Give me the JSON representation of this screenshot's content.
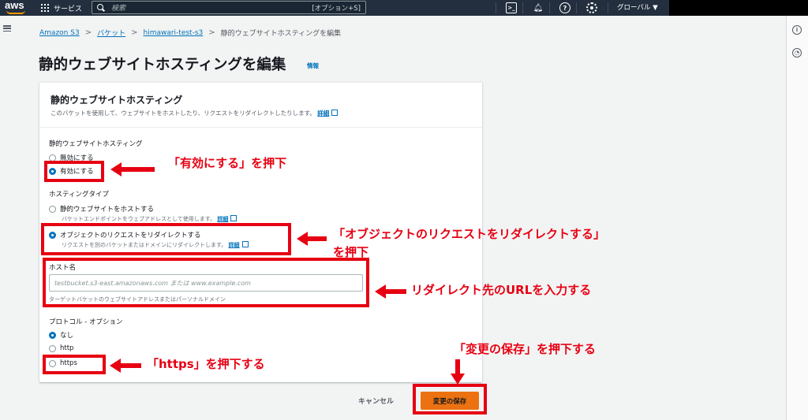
{
  "nav": {
    "logo": "aws",
    "services": "サービス",
    "search_placeholder": "検索",
    "search_shortcut": "[オプション+S]",
    "region": "グローバル ▼",
    "icons": [
      "cloudshell-icon",
      "bell-icon",
      "help-icon",
      "gear-icon"
    ]
  },
  "breadcrumb": {
    "items": [
      "Amazon S3",
      "バケット",
      "himawari-test-s3"
    ],
    "current": "静的ウェブサイトホスティングを編集"
  },
  "page": {
    "title": "静的ウェブサイトホスティングを編集",
    "info": "情報"
  },
  "panel": {
    "title": "静的ウェブサイトホスティング",
    "description": "このバケットを使用して、ウェブサイトをホストしたり、リクエストをリダイレクトしたりします。",
    "details_link": "詳細",
    "hosting": {
      "label": "静的ウェブサイトホスティング",
      "options": [
        "無効にする",
        "有効にする"
      ],
      "selected": "有効にする"
    },
    "hosting_type": {
      "label": "ホスティングタイプ",
      "option1": "静的ウェブサイトをホストする",
      "option1_desc": "バケットエンドポイントをウェブアドレスとして使用します。",
      "option2": "オブジェクトのリクエストをリダイレクトする",
      "option2_desc": "リクエストを別のバケットまたはドメインにリダイレクトします。",
      "link": "詳細",
      "selected": "オブジェクトのリクエストをリダイレクトする"
    },
    "host_name": {
      "label": "ホスト名",
      "placeholder": "testbucket.s3-east.amazonaws.com または www.example.com",
      "value": "",
      "hint": "ターゲットバケットのウェブサイトアドレスまたはパーソナルドメイン"
    },
    "protocol": {
      "label": "プロトコル - オプション",
      "options": [
        "なし",
        "http",
        "https"
      ],
      "selected": "なし"
    }
  },
  "footer": {
    "cancel": "キャンセル",
    "save": "変更の保存"
  },
  "annotations": {
    "enable": "「有効にする」を押下",
    "redirect_line1": "「オブジェクトのリクエストをリダイレクトする」",
    "redirect_line2": "を押下",
    "url": "リダイレクト先のURLを入力する",
    "save": "「変更の保存」を押下する",
    "https": "「https」を押下する",
    "color": "#e60012"
  },
  "colors": {
    "nav_bg": "#232f3e",
    "link": "#0073bb",
    "primary_button": "#ec7211",
    "radio_selected": "#0073bb"
  }
}
